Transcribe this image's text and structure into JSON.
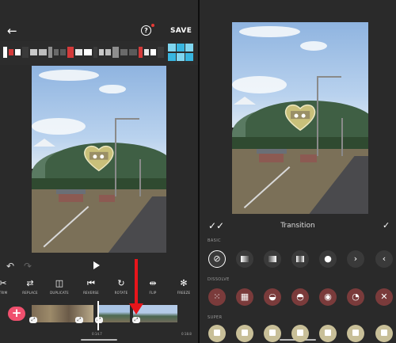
{
  "editor": {
    "save_label": "SAVE",
    "back_icon": "arrow-left-icon",
    "help_icon": "help-circle-icon",
    "play_icon": "play-icon",
    "undo_icon": "undo-icon",
    "redo_icon": "redo-icon",
    "tools": [
      {
        "label": "TRIM",
        "icon": "trim-icon",
        "glyph": "✂"
      },
      {
        "label": "REPLACE",
        "icon": "replace-icon",
        "glyph": "⇄"
      },
      {
        "label": "DUPLICATE",
        "icon": "duplicate-icon",
        "glyph": "◫"
      },
      {
        "label": "REVERSE",
        "icon": "reverse-icon",
        "glyph": "⏮"
      },
      {
        "label": "ROTATE",
        "icon": "rotate-icon",
        "glyph": "↻"
      },
      {
        "label": "FLIP",
        "icon": "flip-icon",
        "glyph": "⇹"
      },
      {
        "label": "FREEZE",
        "icon": "freeze-icon",
        "glyph": "✻"
      }
    ],
    "add_label": "+",
    "timecodes": [
      "0:14.7",
      "0:18.8"
    ]
  },
  "transition_panel": {
    "title": "Transition",
    "apply_all_icon": "double-check-icon",
    "confirm_icon": "check-icon",
    "sections": [
      {
        "label": "BASIC",
        "items": [
          "none-icon",
          "fade-left-icon",
          "fade-right-icon",
          "fade-center-icon",
          "circle-icon",
          "chevron-right-icon",
          "chevron-left-icon"
        ]
      },
      {
        "label": "DISSOLVE",
        "items": [
          "dots-icon",
          "grid-icon",
          "dissolve-3-icon",
          "dissolve-4-icon",
          "dissolve-5-icon",
          "dissolve-6-icon",
          "dissolve-7-icon"
        ]
      },
      {
        "label": "SUPER",
        "items": [
          "super-1-icon",
          "super-2-icon",
          "super-3-icon",
          "super-4-icon",
          "super-5-icon",
          "super-6-icon",
          "super-7-icon"
        ]
      }
    ]
  },
  "colors": {
    "add_button": "#f0506e",
    "annotation_arrow": "#e8151b",
    "dissolve_item": "#7a3b3b",
    "super_item": "#c8bf98"
  }
}
